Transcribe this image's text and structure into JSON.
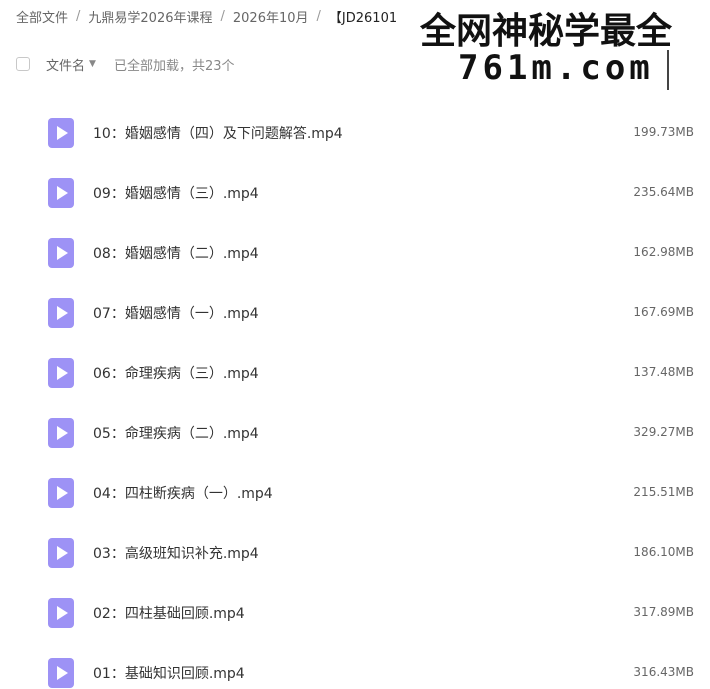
{
  "breadcrumb": {
    "items": [
      "全部文件",
      "九鼎易学2026年课程",
      "2026年10月"
    ],
    "current": "【JD26101",
    "separator": "/"
  },
  "watermark": {
    "line1": "全网神秘学最全",
    "line2": "761m.com"
  },
  "list_header": {
    "sort_label": "文件名",
    "sort_icon": "sort-down-icon",
    "status": "已全部加载，共23个"
  },
  "colors": {
    "video_icon": "#9d92f5"
  },
  "files": [
    {
      "name": "10：婚姻感情（四）及下问题解答.mp4",
      "size": "199.73MB",
      "icon": "video-file-icon"
    },
    {
      "name": "09：婚姻感情（三）.mp4",
      "size": "235.64MB",
      "icon": "video-file-icon"
    },
    {
      "name": "08：婚姻感情（二）.mp4",
      "size": "162.98MB",
      "icon": "video-file-icon"
    },
    {
      "name": "07：婚姻感情（一）.mp4",
      "size": "167.69MB",
      "icon": "video-file-icon"
    },
    {
      "name": "06：命理疾病（三）.mp4",
      "size": "137.48MB",
      "icon": "video-file-icon"
    },
    {
      "name": "05：命理疾病（二）.mp4",
      "size": "329.27MB",
      "icon": "video-file-icon"
    },
    {
      "name": "04：四柱断疾病（一）.mp4",
      "size": "215.51MB",
      "icon": "video-file-icon"
    },
    {
      "name": "03：高级班知识补充.mp4",
      "size": "186.10MB",
      "icon": "video-file-icon"
    },
    {
      "name": "02：四柱基础回顾.mp4",
      "size": "317.89MB",
      "icon": "video-file-icon"
    },
    {
      "name": "01：基础知识回顾.mp4",
      "size": "316.43MB",
      "icon": "video-file-icon"
    }
  ]
}
